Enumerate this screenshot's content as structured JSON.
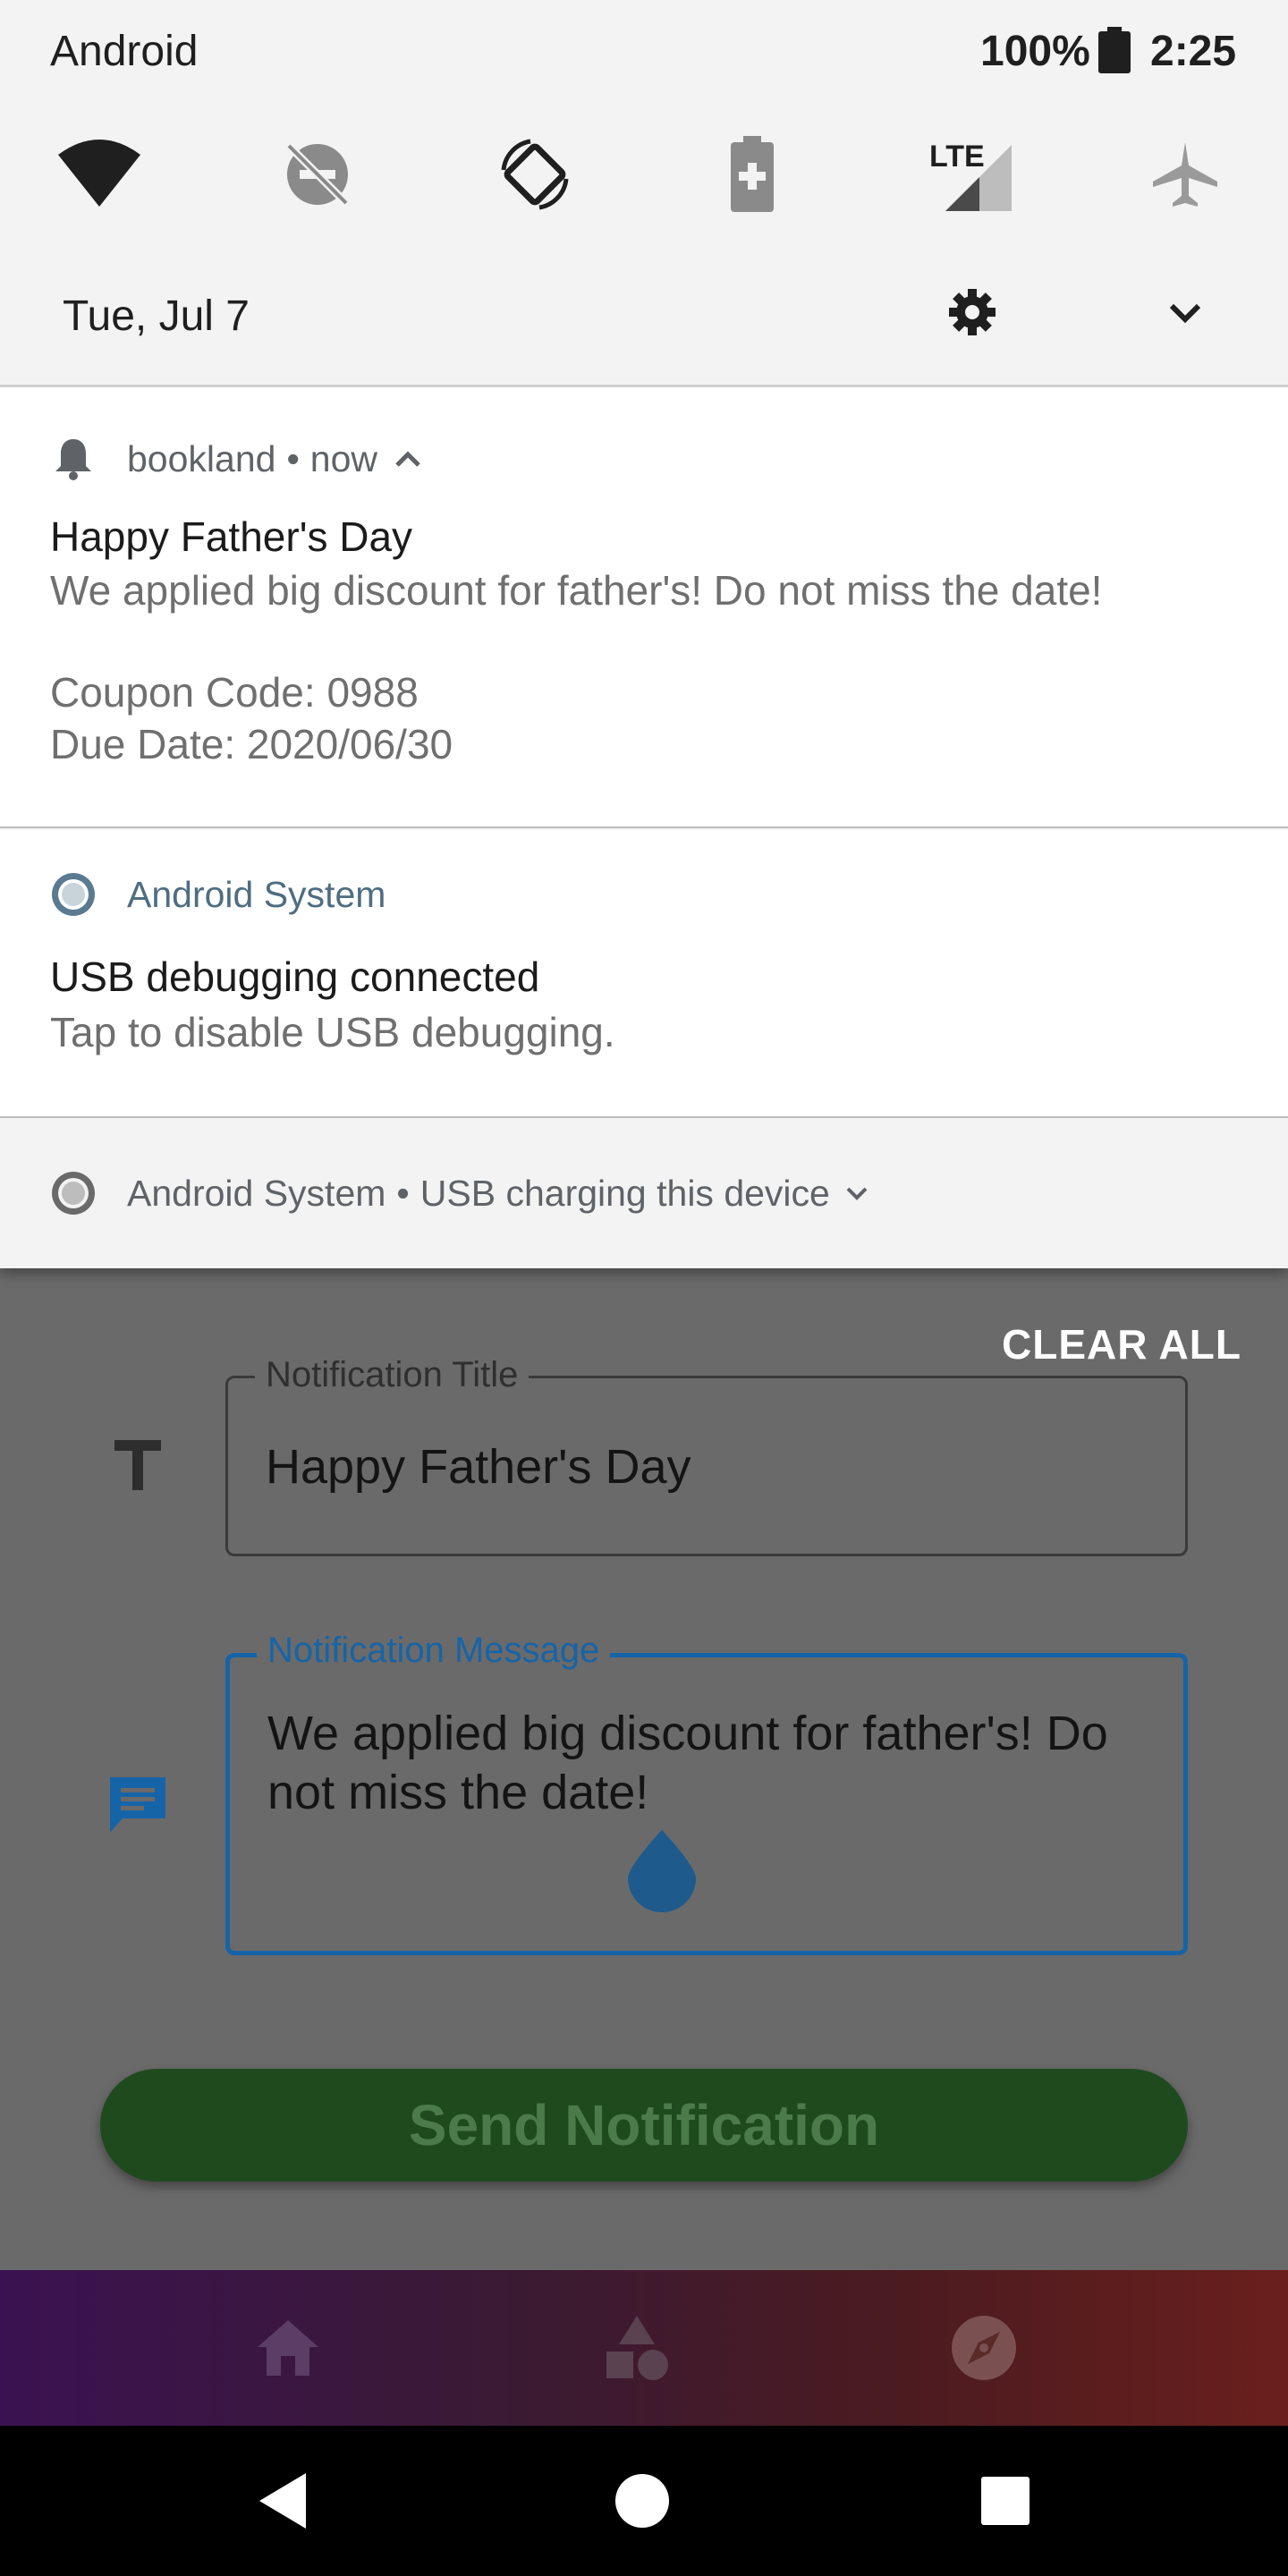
{
  "status_bar": {
    "carrier": "Android",
    "battery_percent": "100%",
    "time": "2:25"
  },
  "quick_settings": {
    "tiles": [
      "wifi-icon",
      "dnd-off-icon",
      "auto-rotate-icon",
      "battery-saver-icon",
      "lte-signal-icon",
      "airplane-mode-icon"
    ],
    "date": "Tue, Jul 7"
  },
  "notifications": [
    {
      "app": "bookland",
      "time": "now",
      "title": "Happy Father's Day",
      "body_line1": "We applied big discount for father's! Do not miss the date!",
      "body_line2": "Coupon Code: 0988",
      "body_line3": "Due Date: 2020/06/30"
    },
    {
      "app": "Android System",
      "title": "USB debugging connected",
      "body": "Tap to disable USB debugging."
    },
    {
      "app": "Android System",
      "summary": "USB charging this device"
    }
  ],
  "shade_actions": {
    "clear_all": "CLEAR ALL"
  },
  "form": {
    "title_label": "Notification Title",
    "title_value": "Happy Father's Day",
    "message_label": "Notification Message",
    "message_value": "We applied big discount for father's! Do not miss the date!",
    "send_button": "Send Notification"
  },
  "bottom_nav": {
    "items": [
      "home-icon",
      "categories-icon",
      "explore-icon"
    ]
  },
  "system_nav": {
    "buttons": [
      "back-icon",
      "home-circle-icon",
      "recents-icon"
    ]
  },
  "colors": {
    "accent_blue": "#1664a8",
    "send_green": "#1f4a1e",
    "nav_gradient_start": "#3b1251",
    "nav_gradient_end": "#6a1f1d"
  }
}
